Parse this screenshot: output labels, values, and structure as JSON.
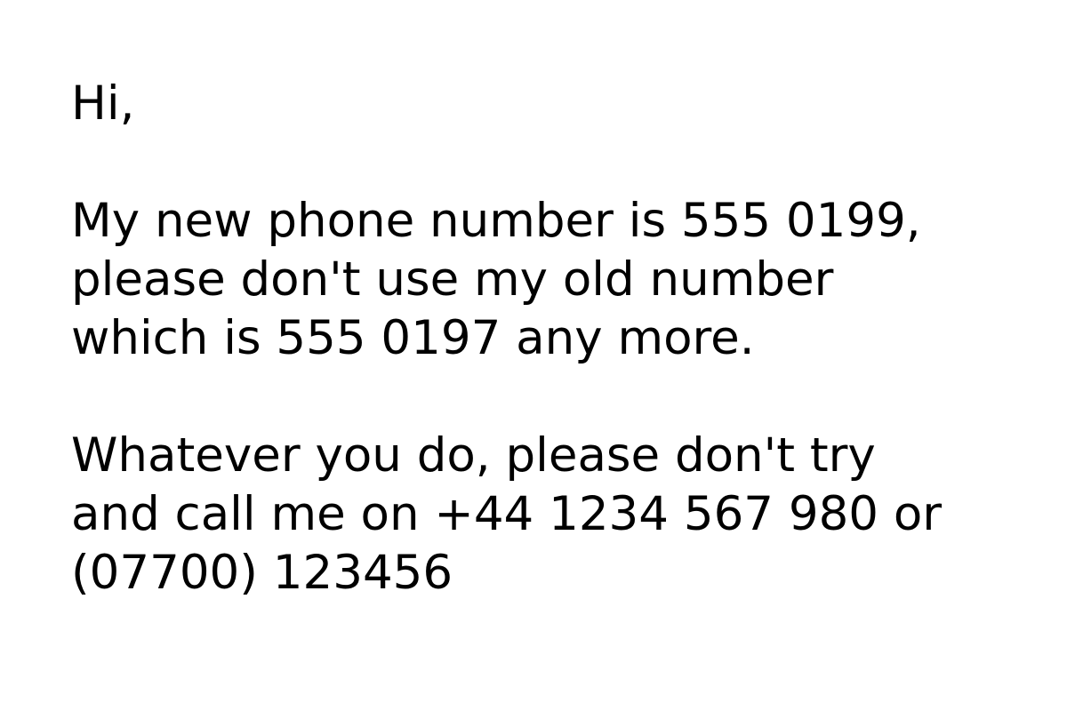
{
  "message": {
    "greeting": "Hi,",
    "paragraph_1": {
      "lines": [
        "My new phone number is 555 0199,",
        "please don't use my old number",
        "which is 555 0197 any more."
      ]
    },
    "paragraph_2": {
      "lines": [
        "Whatever you do, please don't try",
        "and call me on +44 1234 567 980 or",
        "(07700) 123456"
      ]
    }
  }
}
